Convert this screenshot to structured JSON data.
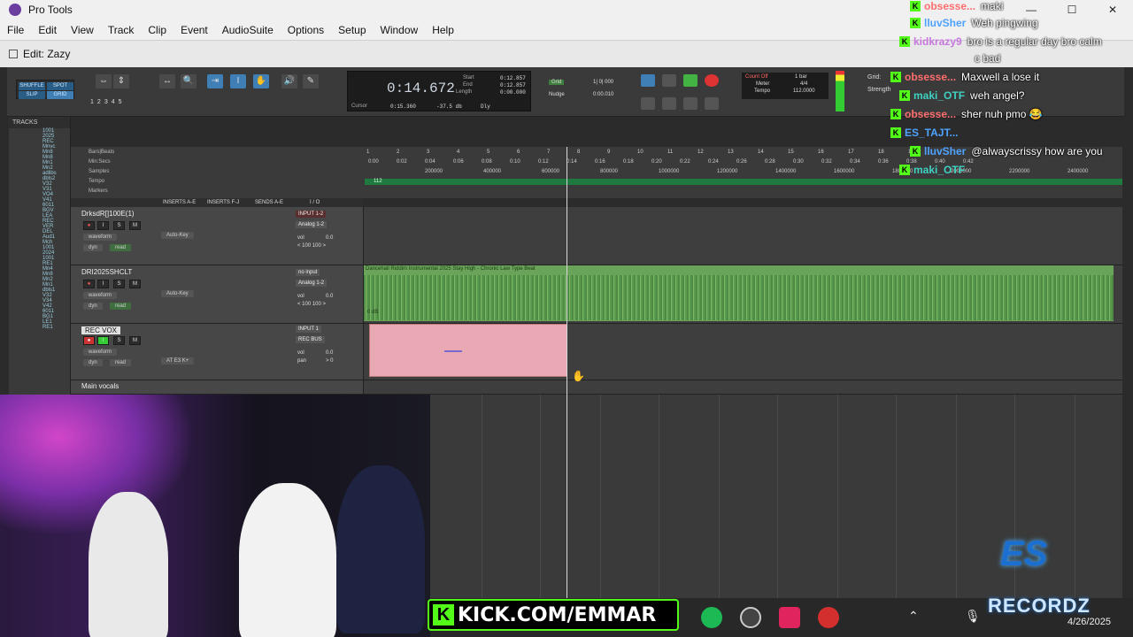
{
  "app": {
    "title": "Pro Tools",
    "window_controls": [
      "—",
      "☐",
      "✕"
    ]
  },
  "menu": [
    "File",
    "Edit",
    "View",
    "Track",
    "Clip",
    "Event",
    "AudioSuite",
    "Options",
    "Setup",
    "Window",
    "Help"
  ],
  "edit_window": {
    "title": "Edit: Zazy"
  },
  "toolbar": {
    "modes": [
      "SHUFFLE",
      "SPOT",
      "SLIP",
      "GRID"
    ],
    "zoom_presets": [
      "1",
      "2",
      "3",
      "4",
      "5"
    ],
    "counter": {
      "main": "0:14.672",
      "start_label": "Start",
      "start": "0:12.857",
      "end_label": "End",
      "end": "0:12.857",
      "length_label": "Length",
      "length": "0:00.000",
      "cursor_label": "Cursor",
      "cursor": "0:15.360",
      "cursor_db": "-37.5 db",
      "dly_label": "Dly"
    },
    "grid_label": "Grid",
    "grid_value": "1| 0| 000",
    "nudge_label": "Nudge",
    "nudge_value": "0:00.010",
    "count_off": "Count Off",
    "meter_label": "Meter",
    "meter_value": "4/4",
    "tempo_label": "Tempo",
    "tempo_value": "112.0000",
    "bars_label": "1 bar",
    "right_grid_label": "Grid:",
    "strength_label": "Strength"
  },
  "tracks_panel": {
    "header": "TRACKS",
    "items": [
      "1001",
      "2025",
      "REC",
      "Mnvc",
      "Mn8",
      "Mn8",
      "Mn1",
      "Mn2",
      "adlibs",
      "dbls2",
      "V32",
      "V31",
      "VO4",
      "V41",
      "6011",
      "BGV",
      "LEA",
      "REC",
      "VER",
      "DEL",
      "Aud1",
      "Mch",
      "1001",
      "2024",
      "1001",
      "RE1",
      "Mn4",
      "Mn8",
      "Mn2",
      "Mn1",
      "dbls1",
      "V32",
      "V34",
      "V42",
      "6011",
      "BG1",
      "LE1",
      "RE1"
    ]
  },
  "rulers": {
    "labels": [
      "Bars|Beats",
      "Min:Secs",
      "Samples",
      "Tempo",
      "Markers"
    ],
    "bar_ticks": [
      "1",
      "2",
      "3",
      "4",
      "5",
      "6",
      "7",
      "8",
      "9",
      "10",
      "11",
      "12",
      "13",
      "14",
      "15",
      "16",
      "17",
      "18",
      "19"
    ],
    "time_ticks": [
      "0:00",
      "0:02",
      "0:04",
      "0:06",
      "0:08",
      "0:10",
      "0:12",
      "0:14",
      "0:16",
      "0:18",
      "0:20",
      "0:22",
      "0:24",
      "0:26",
      "0:28",
      "0:30",
      "0:32",
      "0:34",
      "0:36",
      "0:38",
      "0:40",
      "0:42"
    ],
    "sample_ticks": [
      "200000",
      "400000",
      "600000",
      "800000",
      "1000000",
      "1200000",
      "1400000",
      "1600000",
      "1800000",
      "2000000",
      "2200000",
      "2400000"
    ],
    "tempo_marker": "112"
  },
  "column_headers": [
    "INSERTS A-E",
    "INSERTS F-J",
    "SENDS A-E",
    "I / O"
  ],
  "tracks": [
    {
      "name": "DrksdR[]100E(1)",
      "input": "INPUT 1-2",
      "output": "Analog 1-2",
      "view": "waveform",
      "dyn": "dyn",
      "mode": "read",
      "auto": "Auto-Key",
      "vol_label": "vol",
      "vol": "0.0",
      "pan": "< 100   100 >"
    },
    {
      "name": "DRI2025SHCLT",
      "input": "no input",
      "output": "Analog 1-2",
      "view": "waveform",
      "dyn": "dyn",
      "mode": "read",
      "auto": "Auto-Key",
      "vol_label": "vol",
      "vol": "0.0",
      "pan": "< 100   100 >",
      "clip_title": "Dancehall Riddim Instrumental 2025 Stay High - Chronic Law Type Beat",
      "clip_gain": "0 dB"
    },
    {
      "name": "REC VOX",
      "input": "INPUT 1",
      "output": "REC BUS",
      "view": "waveform",
      "dyn": "dyn",
      "mode": "read",
      "auto": "AT E3 K+",
      "vol_label": "vol",
      "vol": "0.0",
      "pan_label": "pan",
      "pan": "> 0"
    },
    {
      "name": "Main vocals",
      "input": "",
      "output": "",
      "view": "",
      "dyn": "",
      "mode": "",
      "auto": "",
      "vol_label": "",
      "vol": "",
      "pan": ""
    }
  ],
  "chat": [
    {
      "user": "obsesse...",
      "color": "#ff6e6e",
      "text": "maki"
    },
    {
      "user": "lluvSher",
      "color": "#4da3ff",
      "text": "Weh pingwing"
    },
    {
      "user": "kidkrazy9",
      "color": "#c678dd",
      "text": "bro is a regular day bro calm"
    },
    {
      "user": "",
      "color": "#ffffff",
      "text": "c bad"
    },
    {
      "user": "obsesse...",
      "color": "#ff6e6e",
      "text": "Maxwell a lose it"
    },
    {
      "user": "maki_OTF",
      "color": "#3fd1c2",
      "text": "weh angel?"
    },
    {
      "user": "obsesse...",
      "color": "#ff6e6e",
      "text": "sher nuh pmo 😂"
    },
    {
      "user": "ES_TAJT...",
      "color": "#4da3ff",
      "text": ""
    },
    {
      "user": "lluvSher",
      "color": "#4da3ff",
      "text": "@alwayscrissy how are you"
    },
    {
      "user": "maki_OTF",
      "color": "#3fd1c2",
      "text": ""
    }
  ],
  "overlay": {
    "kick_url": "KICK.COM/EMMAR",
    "logo_es": "ES",
    "logo_recordz": "RECORDZ",
    "date": "4/26/2025"
  },
  "colors": {
    "clip_green": "#6aa35a",
    "clip_pink": "#e8a8b4",
    "kick_green": "#53fc18"
  }
}
